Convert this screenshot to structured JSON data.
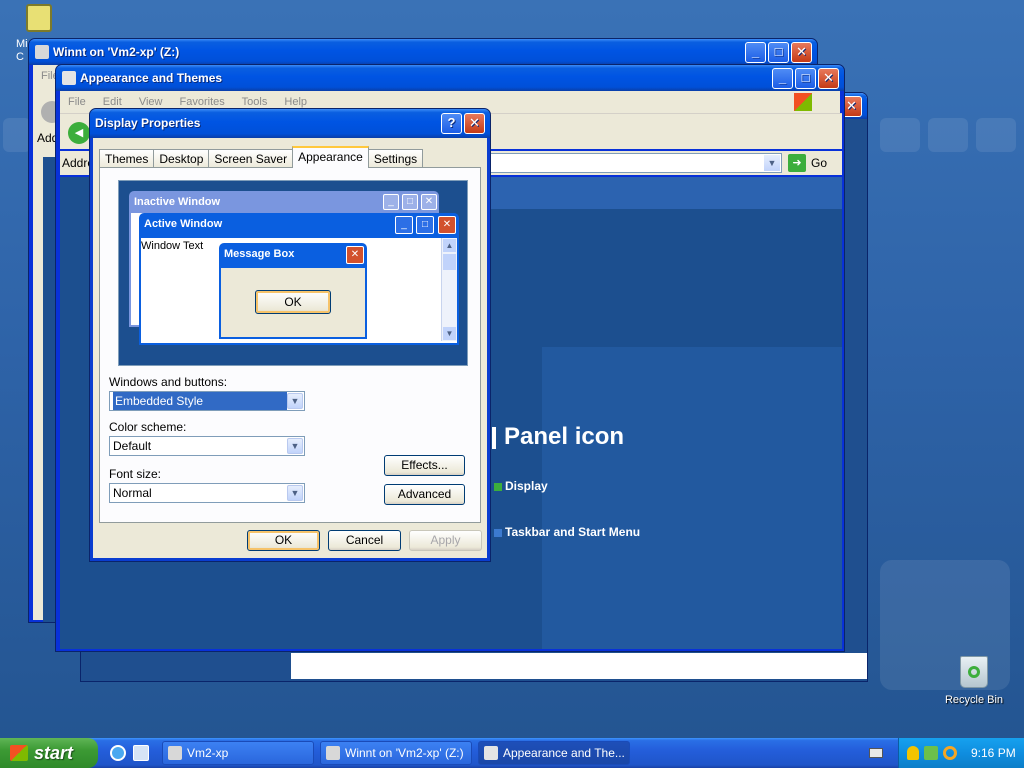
{
  "desktop": {
    "top_icon_label": "Mi C",
    "recycle_bin_label": "Recycle Bin"
  },
  "windows": {
    "winnt": {
      "title": "Winnt on 'Vm2-xp' (Z:)",
      "menu_stub": "File",
      "address_stub": "Add"
    },
    "appearance_themes": {
      "title": "Appearance and Themes",
      "menu": [
        "File",
        "Edit",
        "View",
        "Favorites",
        "Tools",
        "Help"
      ],
      "address_label": "Address",
      "go_label": "Go",
      "heading": "Panel icon",
      "links": [
        "Display",
        "Taskbar and Start Menu"
      ]
    }
  },
  "dialog": {
    "title": "Display Properties",
    "tabs": [
      "Themes",
      "Desktop",
      "Screen Saver",
      "Appearance",
      "Settings"
    ],
    "active_tab": "Appearance",
    "preview": {
      "inactive_title": "Inactive Window",
      "active_title": "Active Window",
      "window_text": "Window Text",
      "msgbox_title": "Message Box",
      "msgbox_ok": "OK"
    },
    "windows_buttons_label": "Windows and buttons:",
    "windows_buttons_value": "Embedded Style",
    "color_scheme_label": "Color scheme:",
    "color_scheme_value": "Default",
    "font_size_label": "Font size:",
    "font_size_value": "Normal",
    "effects_label": "Effects...",
    "advanced_label": "Advanced",
    "ok_label": "OK",
    "cancel_label": "Cancel",
    "apply_label": "Apply"
  },
  "taskbar": {
    "start_label": "start",
    "tasks": [
      "Vm2-xp",
      "Winnt on 'Vm2-xp' (Z:)",
      "Appearance and The..."
    ],
    "clock": "9:16 PM"
  },
  "colors": {
    "xp_blue": "#0054e3",
    "start_green": "#3c9a34",
    "dialog_face": "#ece9d8",
    "selection": "#316ac5",
    "close_red": "#c43a16"
  }
}
